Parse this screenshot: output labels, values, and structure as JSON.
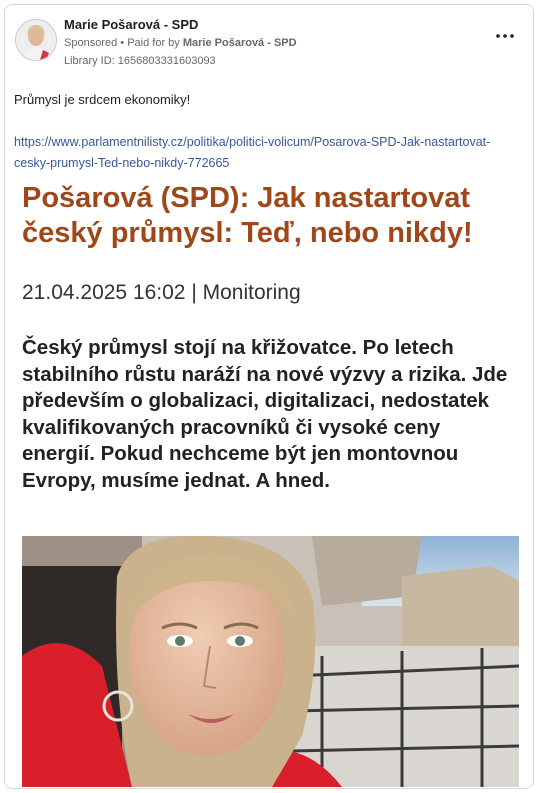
{
  "post": {
    "page_name": "Marie Pošarová - SPD",
    "sponsored_label": "Sponsored",
    "paid_for_prefix": "Paid for by",
    "paid_for_name": "Marie Pošarová - SPD",
    "library_id": "Library ID: 1656803331603093",
    "more_icon": "more-horizontal-icon",
    "text": "Průmysl je srdcem ekonomiky!",
    "link": "https://www.parlamentnilisty.cz/politika/politici-volicum/Posarova-SPD-Jak-nastartovat-cesky-prumysl-Ted-nebo-nikdy-772665"
  },
  "article": {
    "headline": "Pošarová (SPD): Jak nastartovat český průmysl: Teď, nebo nikdy!",
    "meta": "21.04.2025 16:02 | Monitoring",
    "lead": "Český průmysl stojí na křižovatce. Po letech stabilního růstu naráží na nové výzvy a rizika. Jde především o globalizaci, digitalizaci, nedostatek kvalifikovaných pracovníků či vysoké ceny energií. Pokud nechceme být jen montovnou Evropy, musíme jednat. A hned."
  },
  "colors": {
    "headline": "#a0471a",
    "link": "#385898",
    "secondary_text": "#65676b"
  }
}
